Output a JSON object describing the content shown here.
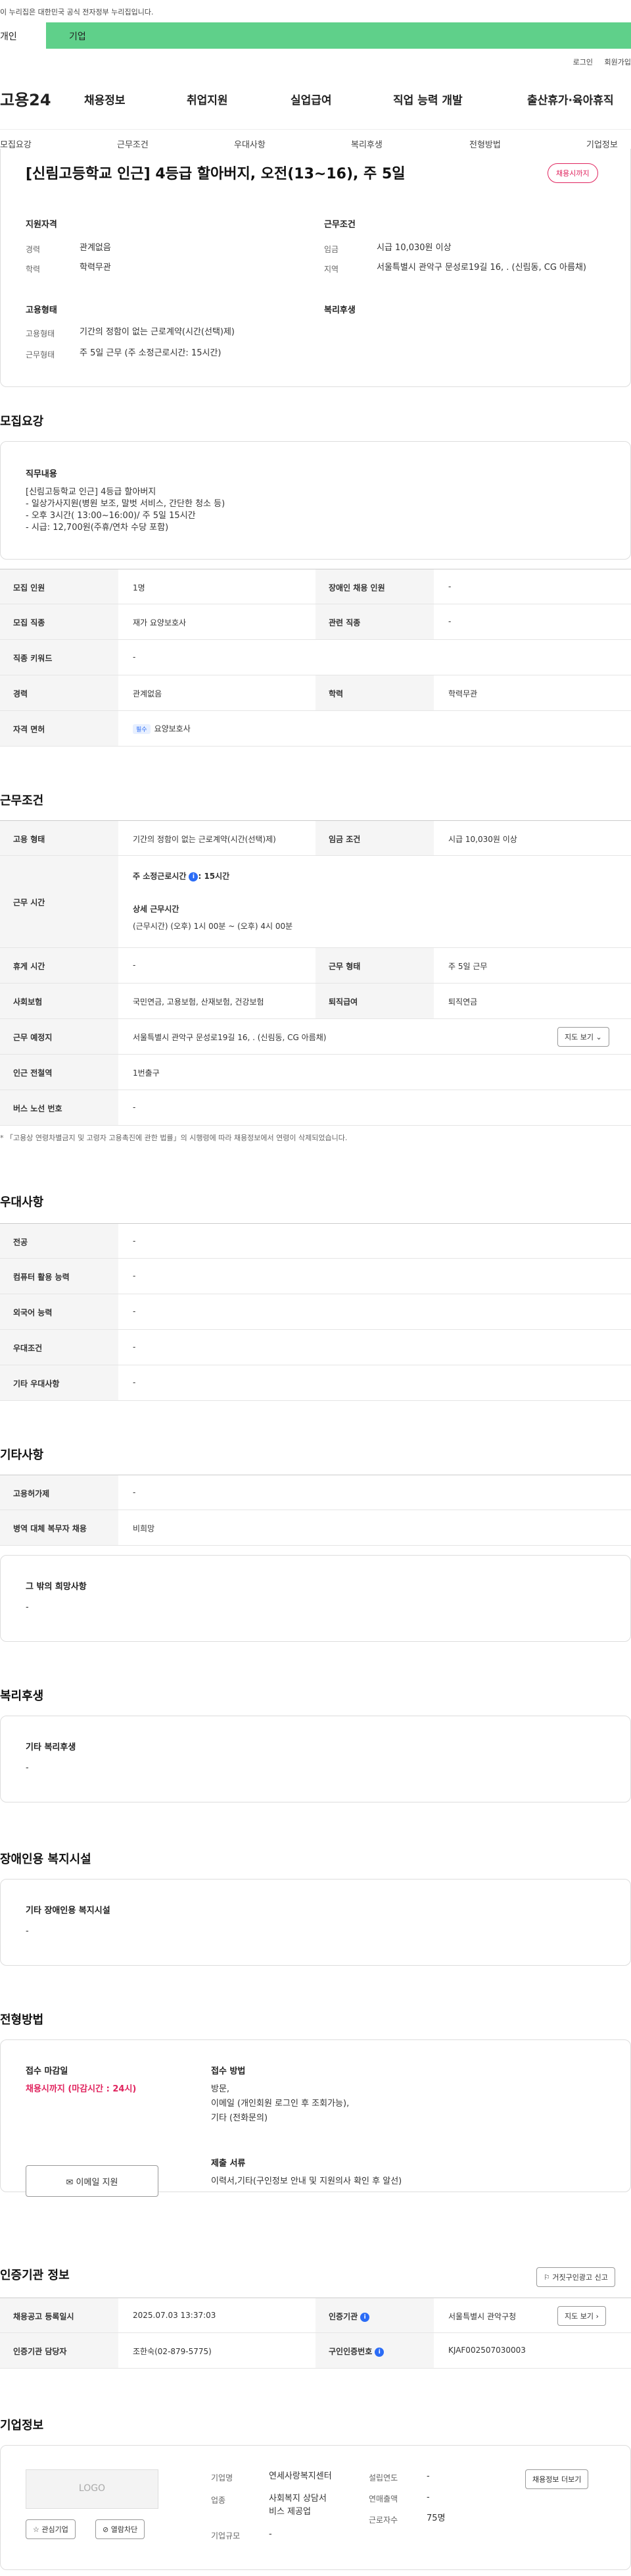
{
  "gov_banner": "이 누리집은 대한민국 공식 전자정부 누리집입니다.",
  "user_tabs": {
    "personal": "개인",
    "company": "기업"
  },
  "util": {
    "login": "로그인",
    "join": "회원가입"
  },
  "logo": "고용24",
  "gnb": [
    "채용정보",
    "취업지원",
    "실업급여",
    "직업 능력 개발",
    "출산휴가·육아휴직"
  ],
  "snb": [
    "모집요강",
    "근무조건",
    "우대사항",
    "복리후생",
    "전형방법",
    "기업정보"
  ],
  "title": "[신림고등학교 인근] 4등급 할아버지, 오전(13~16), 주 5일",
  "status_badge": "채용시까지",
  "summary": {
    "qual_title": "지원자격",
    "career_l": "경력",
    "career_v": "관계없음",
    "edu_l": "학력",
    "edu_v": "학력무관",
    "emp_title": "고용형태",
    "emp_type_l": "고용형태",
    "emp_type_v": "기간의 정함이 없는 근로계약(시간(선택)제)",
    "work_l": "근무형태",
    "work_v": "주 5일 근무 (주 소정근로시간: 15시간)",
    "cond_title": "근무조건",
    "wage_l": "임금",
    "wage_v": "시급 10,030원 이상",
    "region_l": "지역",
    "region_v": "서울특별시 관악구 문성로19길 16, . (신림동, CG 아름채)",
    "welfare_title": "복리후생"
  },
  "recruit": {
    "section": "모집요강",
    "duty_title": "직무내용",
    "duty_lines": [
      "[신림고등학교 인근] 4등급 할아버지",
      "- 일상가사지원(병원 보조, 말벗 서비스, 간단한 청소 등)",
      "- 오후 3시간( 13:00~16:00)/ 주 5일 15시간",
      "- 시급: 12,700원(주휴/연차 수당 포함)"
    ],
    "rows": [
      {
        "l1": "모집 인원",
        "v1": "1명",
        "l2": "장애인 채용 인원",
        "v2": "-"
      },
      {
        "l1": "모집 직종",
        "v1": "재가 요양보호사",
        "l2": "관련 직종",
        "v2": "-"
      },
      {
        "l1": "직종 키워드",
        "v1": "-"
      },
      {
        "l1": "경력",
        "v1": "관계없음",
        "l2": "학력",
        "v2": "학력무관"
      },
      {
        "l1": "자격 면허",
        "tag": "필수",
        "v1": "요양보호사"
      }
    ]
  },
  "conditions": {
    "section": "근무조건",
    "emp_l": "고용 형태",
    "emp_v": "기간의 정함이 없는 근로계약(시간(선택)제)",
    "wage_l": "임금 조건",
    "wage_v": "시급 10,030원 이상",
    "time_l": "근무 시간",
    "hours_label": "주 소정근로시간",
    "hours_value": ": 15시간",
    "detail_label": "상세 근무시간",
    "detail_value": "(근무시간) (오후) 1시 00분 ~ (오후) 4시 00분",
    "rest_l": "휴게 시간",
    "rest_v": "-",
    "form_l": "근무 형태",
    "form_v": "주 5일 근무",
    "ins_l": "사회보험",
    "ins_v": "국민연금, 고용보험, 산재보험, 건강보험",
    "sev_l": "퇴직급여",
    "sev_v": "퇴직연금",
    "place_l": "근무 예정지",
    "place_v": "서울특별시 관악구 문성로19길 16, . (신림동, CG 아름채)",
    "map_btn": "지도 보기",
    "subway_l": "인근 전철역",
    "subway_v": "1번출구",
    "bus_l": "버스 노선 번호",
    "bus_v": "-",
    "note": "* 「고용상 연령차별금지 및 고령자 고용촉진에 관한 법률」의 시행령에 따라 채용정보에서 연령이 삭제되었습니다."
  },
  "pref": {
    "section": "우대사항",
    "rows": [
      {
        "l": "전공",
        "v": "-"
      },
      {
        "l": "컴퓨터 활용 능력",
        "v": "-"
      },
      {
        "l": "외국어 능력",
        "v": "-"
      },
      {
        "l": "우대조건",
        "v": "-"
      },
      {
        "l": "기타 우대사항",
        "v": "-"
      }
    ]
  },
  "etc": {
    "section": "기타사항",
    "rows": [
      {
        "l": "고용허가제",
        "v": "-"
      },
      {
        "l": "병역 대체 복무자 채용",
        "v": "비희망"
      }
    ],
    "wish_title": "그 밖의 희망사항",
    "wish_v": "-"
  },
  "welfare": {
    "section": "복리후생",
    "title": "기타 복리후생",
    "v": "-"
  },
  "disabled": {
    "section": "장애인용 복지시설",
    "title": "기타 장애인용 복지시설",
    "v": "-"
  },
  "selection": {
    "section": "전형방법",
    "deadline_t": "접수 마감일",
    "deadline_v": "채용시까지 (마감시간 : 24시)",
    "method_t": "접수 방법",
    "method_lines": [
      "방문,",
      "이메일 (개인회원 로그인 후 조회가능),",
      "기타 (전화문의)"
    ],
    "docs_t": "제출 서류",
    "docs_v": "이력서,기타(구인정보 안내 및 지원의사 확인 후 알선)",
    "email_btn": "이메일 지원"
  },
  "agency": {
    "section": "인증기관 정보",
    "report_btn": "거짓구인광고 신고",
    "reg_l": "채용공고 등록일시",
    "reg_v": "2025.07.03 13:37:03",
    "org_l": "인증기관",
    "org_v": "서울특별시 관악구청",
    "map_btn": "지도 보기",
    "mgr_l": "인증기관 담당자",
    "mgr_v": "조한숙(02-879-5775)",
    "num_l": "구인인증번호",
    "num_v": "KJAF002507030003"
  },
  "company": {
    "section": "기업정보",
    "logo_text": "LOGO",
    "fav_btn": "관심기업",
    "block_btn": "열람차단",
    "name_l": "기업명",
    "name_v": "연세사랑복지센터",
    "ind_l": "업종",
    "ind_v1": "사회복지 상담서",
    "ind_v2": "비스 제공업",
    "size_l": "기업규모",
    "size_v": "-",
    "year_l": "설립연도",
    "year_v": "-",
    "rev_l": "연매출액",
    "rev_v": "-",
    "emp_l": "근로자수",
    "emp_v": "75명",
    "more_btn": "채용정보 더보기"
  }
}
